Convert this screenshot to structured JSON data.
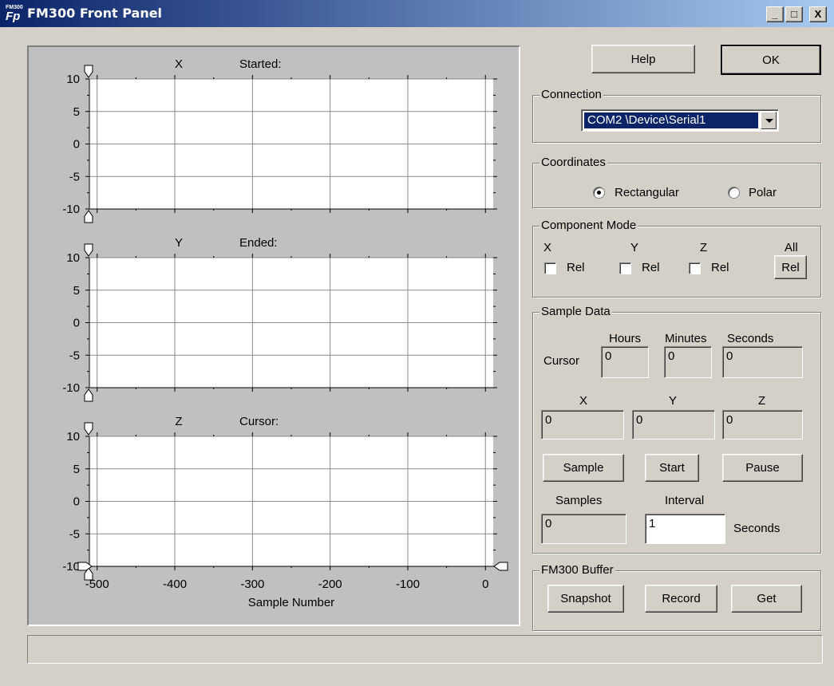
{
  "window": {
    "title": "FM300 Front Panel",
    "icon_top_text": "FM300",
    "icon_text": "Fp",
    "controls": {
      "minimize": "_",
      "maximize": "□",
      "close": "X"
    }
  },
  "plots": [
    {
      "axis": "X",
      "status_label": "Started:"
    },
    {
      "axis": "Y",
      "status_label": "Ended:"
    },
    {
      "axis": "Z",
      "status_label": "Cursor:"
    }
  ],
  "chart_data": {
    "type": "line",
    "y_ticks": [
      "10",
      "5",
      "0",
      "-5",
      "-10"
    ],
    "ylim": [
      -10,
      10
    ],
    "x_ticks": [
      "-500",
      "-400",
      "-300",
      "-200",
      "-100",
      "0"
    ],
    "xlim": [
      -510,
      10
    ],
    "xlabel": "Sample Number",
    "grid": true,
    "series": []
  },
  "buttons": {
    "help": "Help",
    "ok": "OK"
  },
  "connection": {
    "label": "Connection",
    "selected": "COM2 \\Device\\Serial1"
  },
  "coordinates": {
    "label": "Coordinates",
    "rectangular": "Rectangular",
    "polar": "Polar",
    "selected": "Rectangular"
  },
  "component_mode": {
    "label": "Component Mode",
    "x": "X",
    "y": "Y",
    "z": "Z",
    "all": "All",
    "rel": "Rel",
    "all_button": "Rel"
  },
  "sample_data": {
    "label": "Sample Data",
    "hours_label": "Hours",
    "minutes_label": "Minutes",
    "seconds_label": "Seconds",
    "cursor_label": "Cursor",
    "hours": "0",
    "minutes": "0",
    "seconds": "0",
    "x_label": "X",
    "y_label": "Y",
    "z_label": "Z",
    "x": "0",
    "y": "0",
    "z": "0",
    "sample_button": "Sample",
    "start_button": "Start",
    "pause_button": "Pause",
    "samples_label": "Samples",
    "interval_label": "Interval",
    "samples": "0",
    "interval": "1",
    "interval_unit": "Seconds"
  },
  "buffer": {
    "label": "FM300 Buffer",
    "snapshot": "Snapshot",
    "record": "Record",
    "get": "Get"
  },
  "status_bar": ""
}
